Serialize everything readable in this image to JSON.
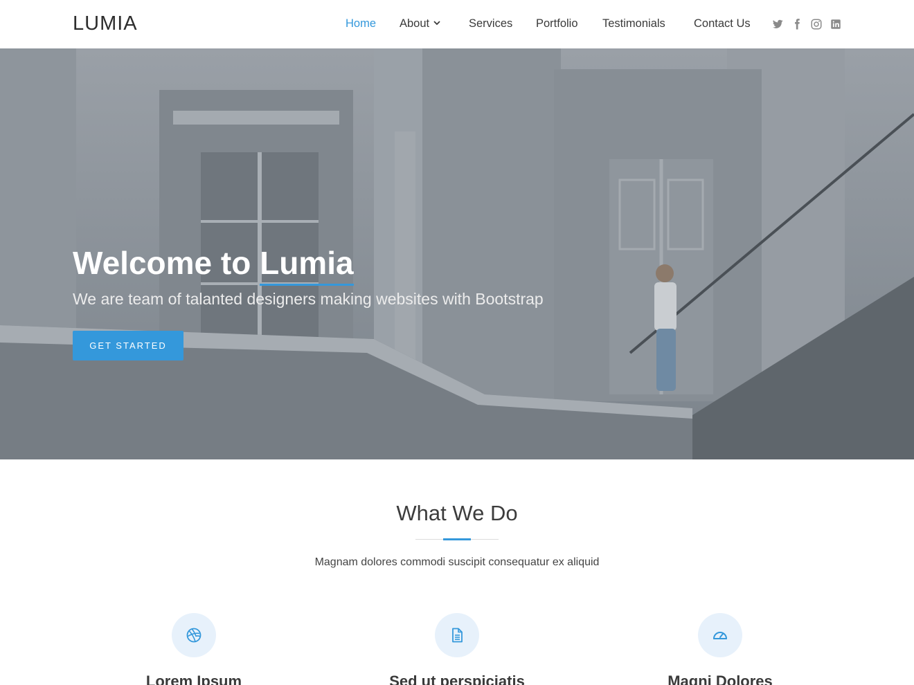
{
  "header": {
    "logo": "LUMIA",
    "nav": [
      {
        "label": "Home",
        "active": true
      },
      {
        "label": "About",
        "has_dropdown": true
      },
      {
        "label": "Services"
      },
      {
        "label": "Portfolio"
      },
      {
        "label": "Testimonials"
      },
      {
        "label": "Contact Us"
      }
    ],
    "social_icons": [
      "twitter-icon",
      "facebook-icon",
      "instagram-icon",
      "linkedin-icon"
    ]
  },
  "hero": {
    "title_prefix": "Welcome to",
    "title_brand": "Lumia",
    "subtitle": "We are team of talanted designers making websites with Bootstrap",
    "cta_label": "GET STARTED"
  },
  "what_we_do": {
    "title": "What We Do",
    "subtitle": "Magnam dolores commodi suscipit consequatur ex aliquid",
    "services": [
      {
        "icon": "dribbble-icon",
        "title": "Lorem Ipsum"
      },
      {
        "icon": "document-icon",
        "title": "Sed ut perspiciatis"
      },
      {
        "icon": "speedometer-icon",
        "title": "Magni Dolores"
      }
    ]
  },
  "colors": {
    "accent": "#3498db",
    "hero_overlay": "#6b737c",
    "icon_circle": "#e7f1fb"
  }
}
